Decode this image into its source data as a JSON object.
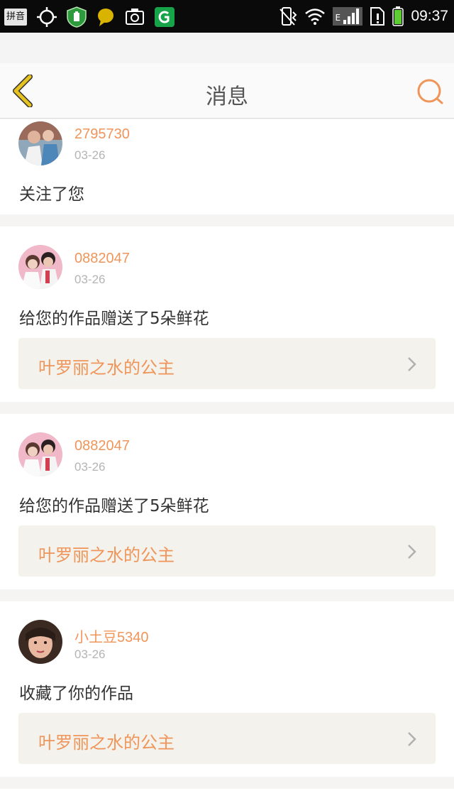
{
  "status_bar": {
    "input_method": "拼音",
    "time": "09:37",
    "network_label": "E",
    "colors": {
      "background": "#0a0a0a",
      "shield": "#2d9a3e",
      "bubble": "#d8b400",
      "app_green": "#17a34a",
      "battery": "#5ecc34"
    }
  },
  "header": {
    "title": "消息",
    "back_icon": "chevron-left-icon",
    "search_icon": "search-icon",
    "accent_back": "#e6c21e",
    "accent_search": "#f0955a"
  },
  "messages": [
    {
      "username": "2795730",
      "date": "03-26",
      "text": "关注了您",
      "work_title": ""
    },
    {
      "username": "0882047",
      "date": "03-26",
      "text": "给您的作品赠送了5朵鲜花",
      "work_title": "叶罗丽之水的公主"
    },
    {
      "username": "0882047",
      "date": "03-26",
      "text": "给您的作品赠送了5朵鲜花",
      "work_title": "叶罗丽之水的公主"
    },
    {
      "username": "小土豆5340",
      "date": "03-26",
      "text": "收藏了你的作品",
      "work_title": "叶罗丽之水的公主"
    }
  ],
  "colors": {
    "accent": "#f0955a",
    "page_bg": "#f5f4f2",
    "work_box_bg": "#f3f2ec"
  }
}
